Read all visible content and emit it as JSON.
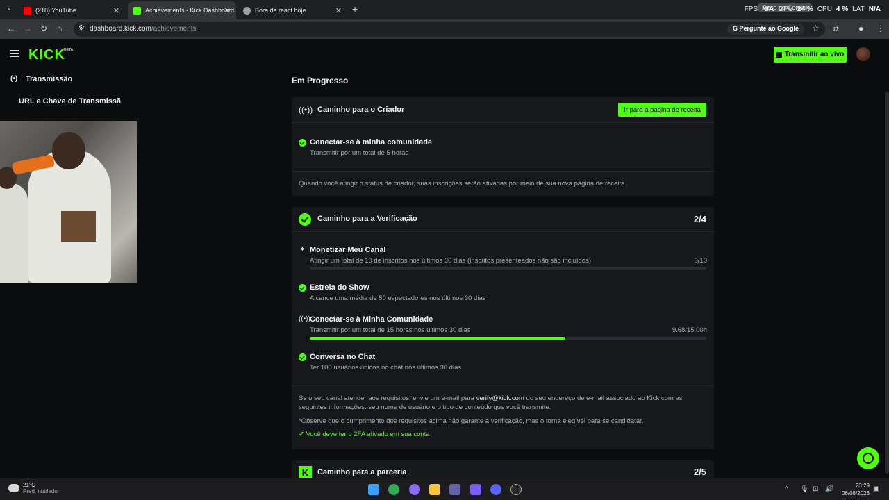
{
  "browser": {
    "tabs": [
      {
        "label": "(218) YouTube",
        "color": "#ff0000"
      },
      {
        "label": "Achievements - Kick Dashboard",
        "color": "#53fc18"
      },
      {
        "label": "Bora de react hoje",
        "color": "#9aa0a6"
      }
    ],
    "new_tab": "+",
    "gemini_pill": "Pesq ao Gemini",
    "stats": {
      "fps_label": "FPS",
      "fps_value": "N/A",
      "gpu_label": "GPU",
      "gpu_value": "24 %",
      "cpu_label": "CPU",
      "cpu_value": "4 %",
      "lat_label": "LAT",
      "lat_value": "N/A"
    },
    "url_host": "dashboard.kick.com",
    "url_path": "/achievements",
    "google_button": "Pergunte ao Google"
  },
  "header": {
    "logo": "KICK",
    "beta": "BETA",
    "go_live": "Transmitir ao vivo"
  },
  "sidebar": {
    "section": "Transmissão",
    "item": "URL e Chave de Transmissã"
  },
  "main": {
    "section_title": "Em Progresso",
    "creator": {
      "title": "Caminho para o Criador",
      "button": "Ir para a página de receita",
      "req_title": "Conectar-se à minha comunidade",
      "req_desc": "Transmitir por um total de 5 horas",
      "note": "Quando você atingir o status de criador, suas inscrições serão ativadas por meio de sua nova página de receita"
    },
    "verification": {
      "title": "Caminho para a Verificação",
      "count": "2/4",
      "requirements": [
        {
          "title": "Monetizar Meu Canal",
          "desc": "Atingir um total de 10 de inscritos nos últimos 30 dias (inscritos presenteados não são incluídos)",
          "value": "0/10",
          "progress": 0,
          "status": "pending"
        },
        {
          "title": "Estrela do Show",
          "desc": "Alcance uma média de 50 espectadores nos últimos 30 dias",
          "status": "done"
        },
        {
          "title": "Conectar-se à Minha Comunidade",
          "desc": "Transmitir por um total de 15 horas nos últimos 30 dias",
          "value": "9.68/15.00h",
          "progress": 0.645,
          "status": "pending"
        },
        {
          "title": "Conversa no Chat",
          "desc": "Ter 100 usuários únicos no chat nos últimos 30 dias",
          "status": "done"
        }
      ],
      "note_1a": "Se o seu canal atender aos requisitos, envie um e-mail para ",
      "note_email": "verify@kick.com",
      "note_1b": " do seu endereço de e-mail associado ao Kick com as seguintes informações: seu nome de usuário e o tipo de conteúdo que você transmite.",
      "note_2": "*Observe que o cumprimento dos requisitos acima não garante a verificação, mas o torna elegível para se candidatar.",
      "twofa": "Você deve ter o 2FA ativado em sua conta"
    },
    "partner": {
      "title": "Caminho para a parceria",
      "count": "2/5"
    }
  },
  "taskbar": {
    "temp": "21°C",
    "weather": "Pred. nublado",
    "time": "23:29",
    "date": "06/08/2026"
  },
  "colors": {
    "accent": "#53fc18",
    "background": "#0b0c0e",
    "card": "#17181b"
  }
}
